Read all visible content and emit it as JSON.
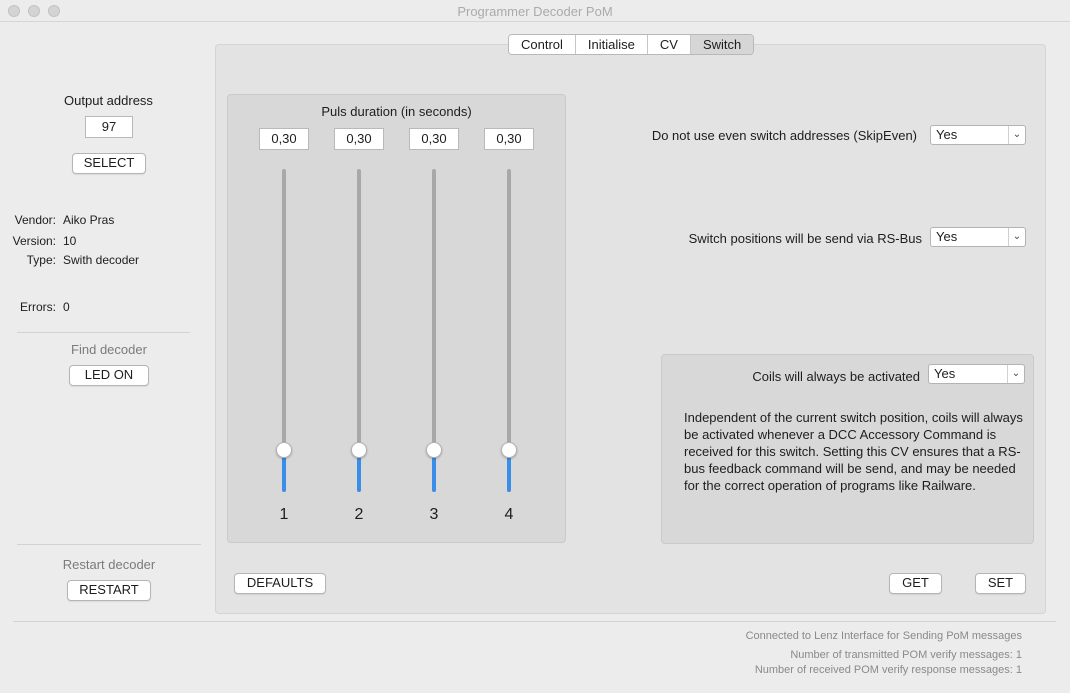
{
  "window": {
    "title": "Programmer Decoder PoM"
  },
  "left": {
    "output_address_label": "Output address",
    "output_address_value": "97",
    "select_label": "SELECT",
    "info": [
      {
        "key": "Vendor:",
        "value": "Aiko Pras"
      },
      {
        "key": "Version:",
        "value": "10"
      },
      {
        "key": "Type:",
        "value": "Swith decoder"
      }
    ],
    "errors_key": "Errors:",
    "errors_value": "0",
    "find_label": "Find decoder",
    "led_label": "LED ON",
    "restart_label": "Restart decoder",
    "restart_button": "RESTART"
  },
  "tabs": [
    {
      "label": "Control",
      "selected": false
    },
    {
      "label": "Initialise",
      "selected": false
    },
    {
      "label": "CV",
      "selected": false
    },
    {
      "label": "Switch",
      "selected": true
    }
  ],
  "sliders": {
    "title": "Puls duration (in seconds)",
    "items": [
      {
        "value": "0,30",
        "label": "1",
        "level": 0.13
      },
      {
        "value": "0,30",
        "label": "2",
        "level": 0.13
      },
      {
        "value": "0,30",
        "label": "3",
        "level": 0.13
      },
      {
        "value": "0,30",
        "label": "4",
        "level": 0.13
      }
    ]
  },
  "settings": {
    "skip_even": {
      "label": "Do not use even switch addresses  (SkipEven)",
      "value": "Yes"
    },
    "rs_bus": {
      "label": "Switch positions will be send via RS-Bus",
      "value": "Yes"
    },
    "coils": {
      "label": "Coils will always be activated",
      "value": "Yes",
      "description": "Independent of the current switch position, coils will always be activated whenever a DCC Accessory Command is received for this switch. Setting this CV ensures that a RS-bus feedback command will be send, and may be needed for the correct operation of programs like Railware."
    }
  },
  "buttons": {
    "defaults": "DEFAULTS",
    "get": "GET",
    "set": "SET"
  },
  "status": {
    "connected": "Connected to Lenz Interface for Sending PoM messages",
    "transmitted": "Number of transmitted POM verify messages: 1",
    "received": "Number of received POM verify response messages: 1"
  },
  "colors": {
    "accent": "#3b8ee8"
  }
}
